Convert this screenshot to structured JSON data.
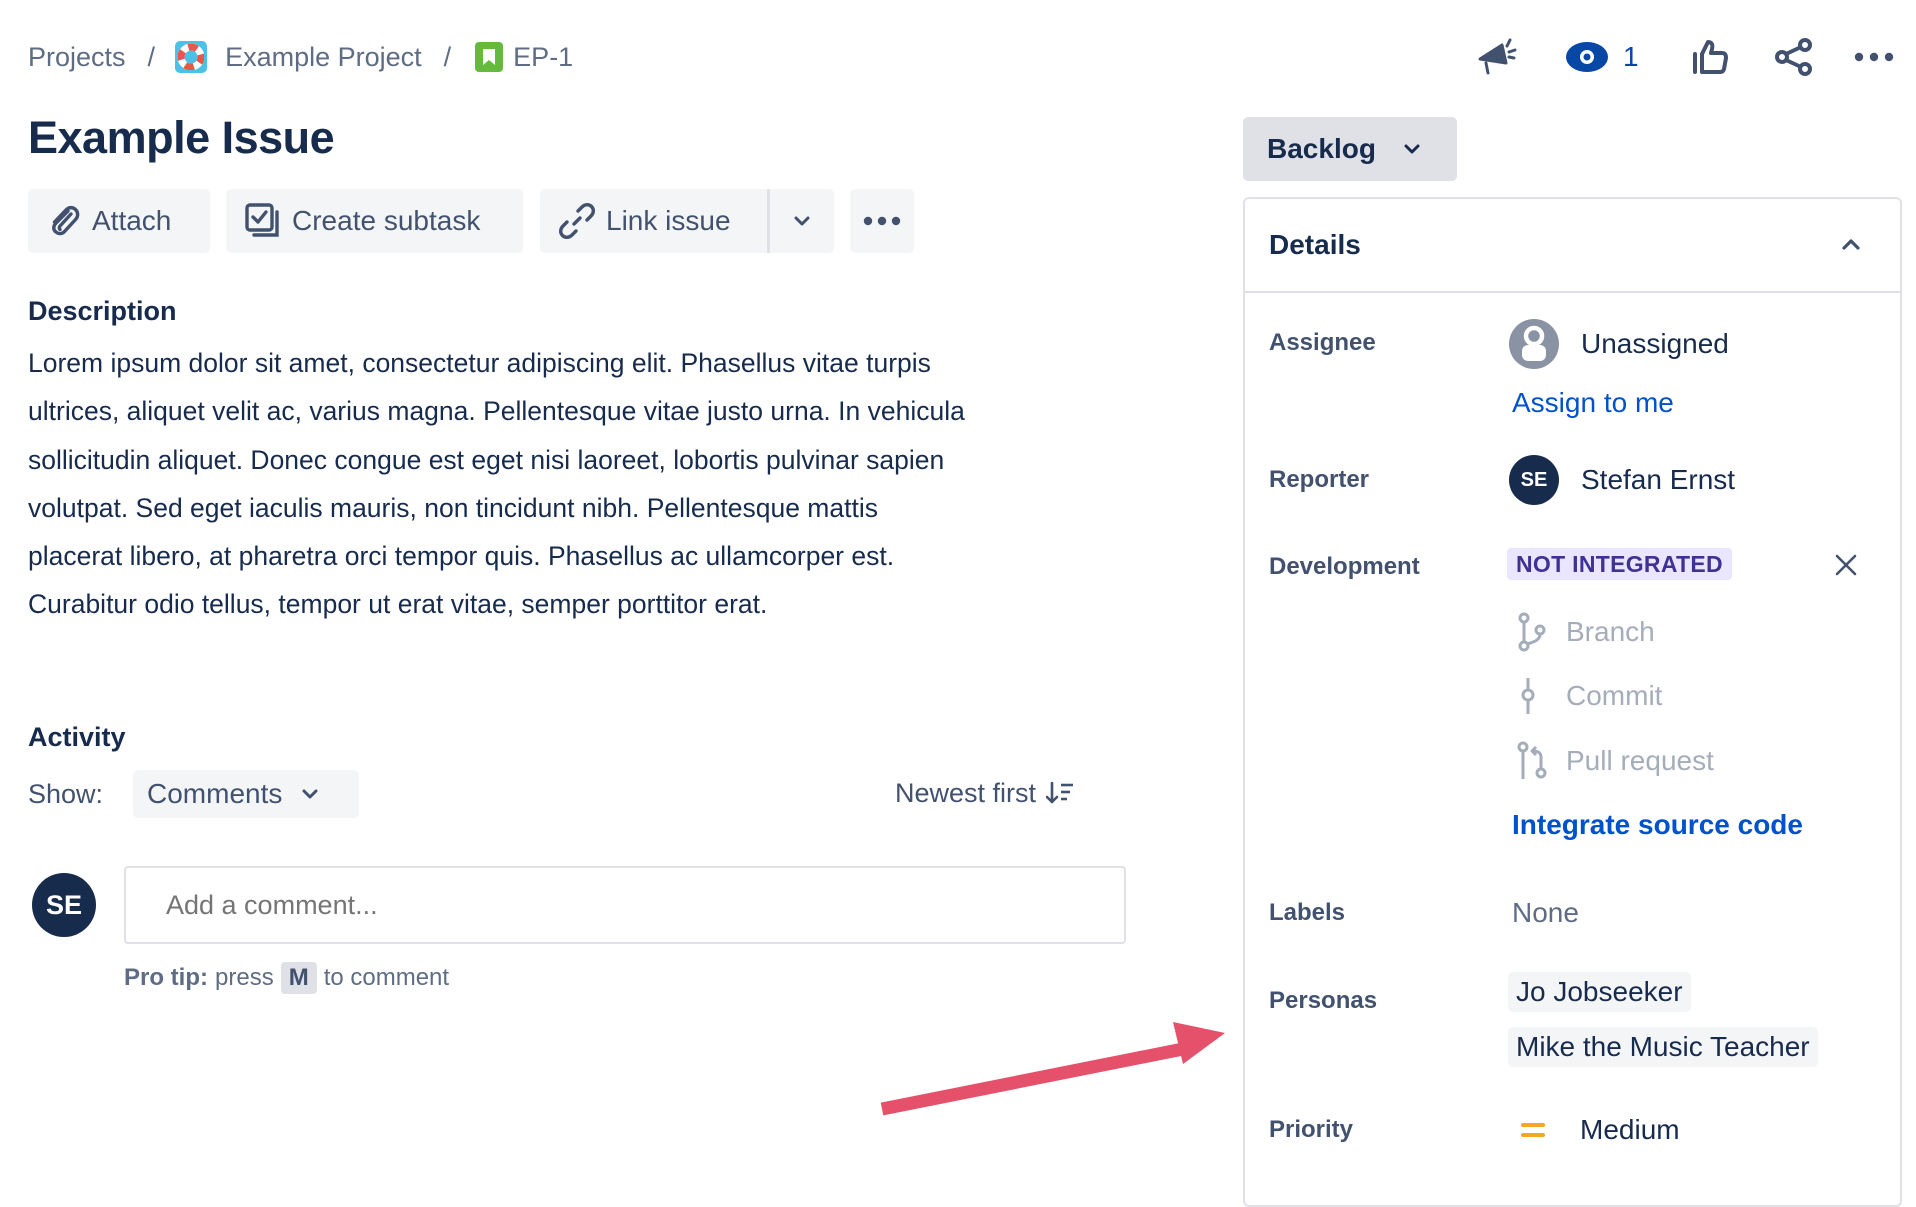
{
  "breadcrumb": {
    "items": [
      {
        "label": "Projects",
        "icon": null
      },
      {
        "label": "Example Project",
        "icon": "project-lifebuoy-icon"
      },
      {
        "label": "EP-1",
        "icon": "story-bookmark-icon"
      }
    ],
    "separator": "/"
  },
  "top_actions": {
    "feedback_icon": "megaphone-icon",
    "watch_icon": "eye-icon",
    "watch_count": "1",
    "vote_icon": "thumbs-up-icon",
    "share_icon": "share-icon",
    "more_icon": "more-horizontal-icon"
  },
  "issue": {
    "title": "Example Issue"
  },
  "toolbar": {
    "attach_label": "Attach",
    "create_subtask_label": "Create subtask",
    "link_issue_label": "Link issue",
    "link_dropdown_icon": "chevron-down-icon",
    "more_icon": "more-horizontal-icon"
  },
  "description": {
    "heading": "Description",
    "lines": [
      "Lorem ipsum dolor sit amet, consectetur adipiscing elit. Phasellus vitae turpis",
      "ultrices, aliquet velit ac, varius magna. Pellentesque vitae justo urna. In vehicula",
      "sollicitudin aliquet. Donec congue est eget nisi laoreet, lobortis pulvinar sapien",
      "volutpat. Sed eget iaculis mauris, non tincidunt nibh. Pellentesque mattis",
      "placerat libero, at pharetra orci tempor quis. Phasellus ac ullamcorper est.",
      "Curabitur odio tellus, tempor ut erat vitae, semper porttitor erat."
    ]
  },
  "activity": {
    "heading": "Activity",
    "show_label": "Show:",
    "filter_value": "Comments",
    "sort_label": "Newest first",
    "comment_avatar_initials": "SE",
    "comment_placeholder": "Add a comment...",
    "pro_tip_bold": "Pro tip:",
    "pro_tip_pre": "press",
    "pro_tip_key": "M",
    "pro_tip_post": "to comment"
  },
  "status": {
    "value": "Backlog"
  },
  "details": {
    "heading": "Details",
    "assignee": {
      "label": "Assignee",
      "value": "Unassigned",
      "action": "Assign to me"
    },
    "reporter": {
      "label": "Reporter",
      "initials": "SE",
      "value": "Stefan Ernst"
    },
    "development": {
      "label": "Development",
      "badge": "NOT INTEGRATED",
      "items": [
        "Branch",
        "Commit",
        "Pull request"
      ],
      "action": "Integrate source code"
    },
    "labels": {
      "label": "Labels",
      "value": "None"
    },
    "personas": {
      "label": "Personas",
      "values": [
        "Jo Jobseeker",
        "Mike the Music Teacher"
      ]
    },
    "priority": {
      "label": "Priority",
      "value": "Medium",
      "color": "#f5a623"
    }
  },
  "annotation": {
    "arrow_color": "#e5506a",
    "points_to": "Personas"
  },
  "colors": {
    "text_primary": "#172b4d",
    "text_secondary": "#42526e",
    "link": "#0052cc",
    "badge_bg": "#eae6ff",
    "badge_text": "#403294"
  }
}
